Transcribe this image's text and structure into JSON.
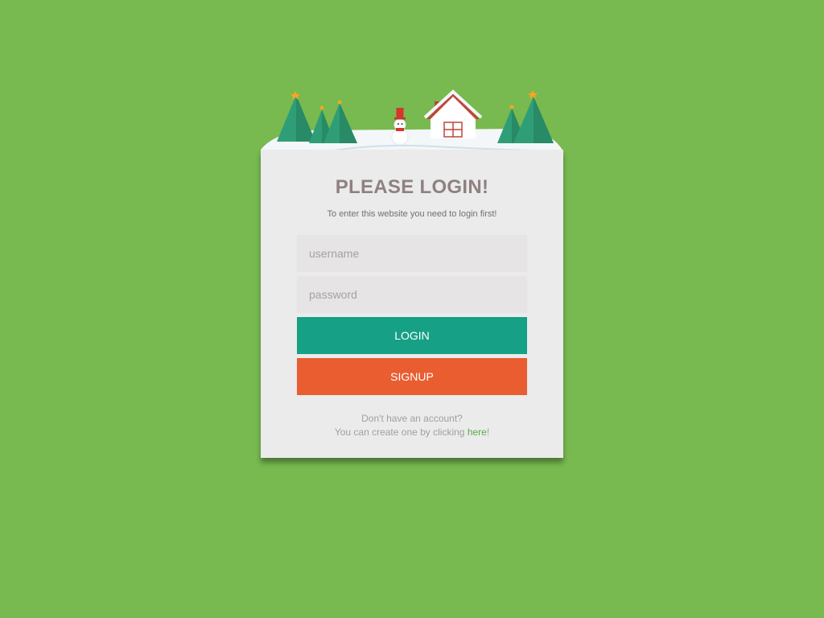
{
  "page": {
    "background_color": "#78b950"
  },
  "scene": {
    "icons": [
      "christmas-tree-icon",
      "snowman-icon",
      "house-icon",
      "snow-ground-icon"
    ]
  },
  "card": {
    "title": "PLEASE LOGIN!",
    "subtitle": "To enter this website you need to login first!",
    "username_placeholder": "username",
    "username_value": "",
    "password_placeholder": "password",
    "password_value": "",
    "login_label": "LOGIN",
    "signup_label": "SIGNUP",
    "footer_line1": "Don't have an account?",
    "footer_line2_prefix": "You can create one by clicking ",
    "footer_link": "here",
    "footer_line2_suffix": "!"
  },
  "colors": {
    "login_button": "#16a085",
    "signup_button": "#e95d30",
    "link": "#5aaa4a",
    "title": "#8f8180"
  }
}
